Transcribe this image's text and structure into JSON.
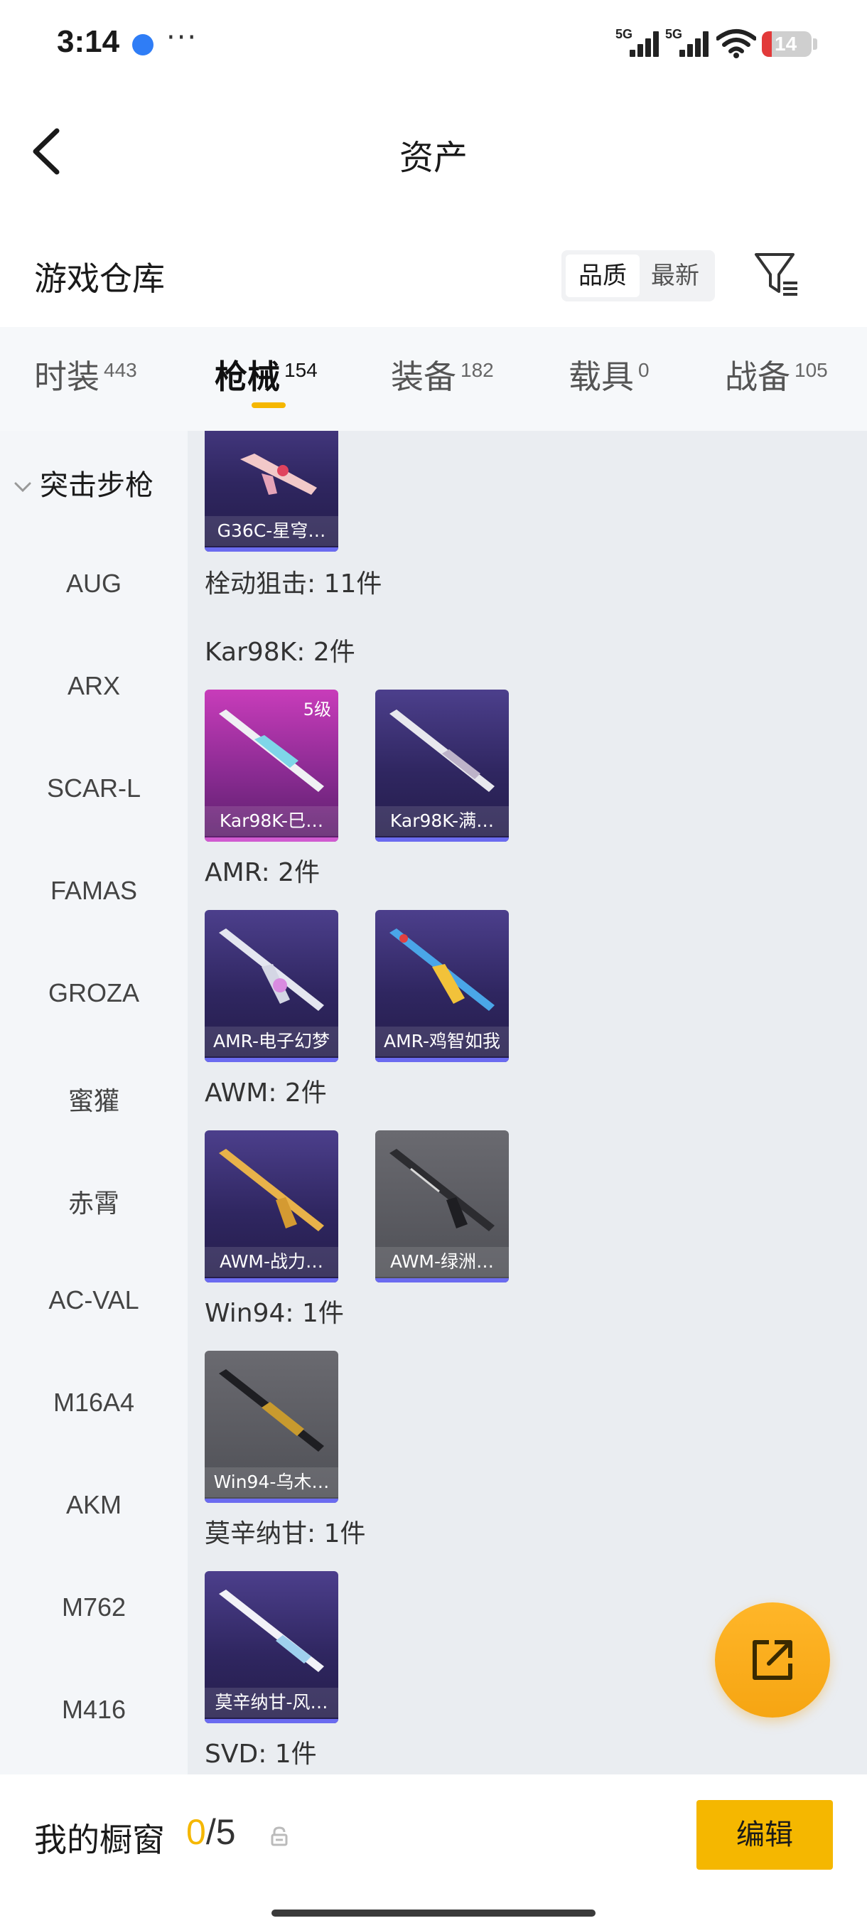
{
  "status_bar": {
    "time": "3:14",
    "more": "···",
    "signal1_label": "5G",
    "signal2_label": "5G",
    "battery": "14",
    "icons": [
      "app-icon",
      "signal-icon",
      "signal-icon",
      "wifi-icon",
      "battery-icon"
    ]
  },
  "header": {
    "title": "资产",
    "back_icon": "chevron-left-icon"
  },
  "section": {
    "title": "游戏仓库",
    "sort_options": [
      "品质",
      "最新"
    ],
    "sort_selected": "品质",
    "filter_icon": "filter-icon"
  },
  "tabs": [
    {
      "label": "时装",
      "count": "443",
      "active": false
    },
    {
      "label": "枪械",
      "count": "154",
      "active": true
    },
    {
      "label": "装备",
      "count": "182",
      "active": false
    },
    {
      "label": "载具",
      "count": "0",
      "active": false
    },
    {
      "label": "战备",
      "count": "105",
      "active": false
    }
  ],
  "categories": {
    "header": "突击步枪",
    "items": [
      "AUG",
      "ARX",
      "SCAR-L",
      "FAMAS",
      "GROZA",
      "蜜獾",
      "赤霄",
      "AC-VAL",
      "M16A4",
      "AKM",
      "M762",
      "M416"
    ]
  },
  "content": {
    "top_card": {
      "name": "G36C-星穹…",
      "style": "purple"
    },
    "subcategory_title": "栓动狙击: 11件",
    "groups": [
      {
        "title": "Kar98K: 2件",
        "cards": [
          {
            "name": "Kar98K-巳…",
            "style": "pink",
            "level": "5级"
          },
          {
            "name": "Kar98K-满…",
            "style": "purple",
            "level": ""
          }
        ]
      },
      {
        "title": "AMR: 2件",
        "cards": [
          {
            "name": "AMR-电子幻梦",
            "style": "purple",
            "level": ""
          },
          {
            "name": "AMR-鸡智如我",
            "style": "purple",
            "level": ""
          }
        ]
      },
      {
        "title": "AWM: 2件",
        "cards": [
          {
            "name": "AWM-战力…",
            "style": "purple",
            "level": ""
          },
          {
            "name": "AWM-绿洲…",
            "style": "gray",
            "level": ""
          }
        ]
      },
      {
        "title": "Win94: 1件",
        "cards": [
          {
            "name": "Win94-乌木…",
            "style": "gray",
            "level": ""
          }
        ]
      },
      {
        "title": "莫辛纳甘: 1件",
        "cards": [
          {
            "name": "莫辛纳甘-风…",
            "style": "purple",
            "level": ""
          }
        ]
      },
      {
        "title": "SVD: 1件",
        "cards": []
      }
    ]
  },
  "fab": {
    "icon": "share-external-icon"
  },
  "bottom_bar": {
    "label": "我的橱窗",
    "current": "0",
    "separator": "/",
    "total": "5",
    "lock_icon": "lock-icon",
    "edit_label": "编辑"
  },
  "colors": {
    "accent": "#f5b700",
    "fab": "#ffb629",
    "content_bg": "#eaedf1",
    "sidebar_bg": "#f4f6f9"
  }
}
